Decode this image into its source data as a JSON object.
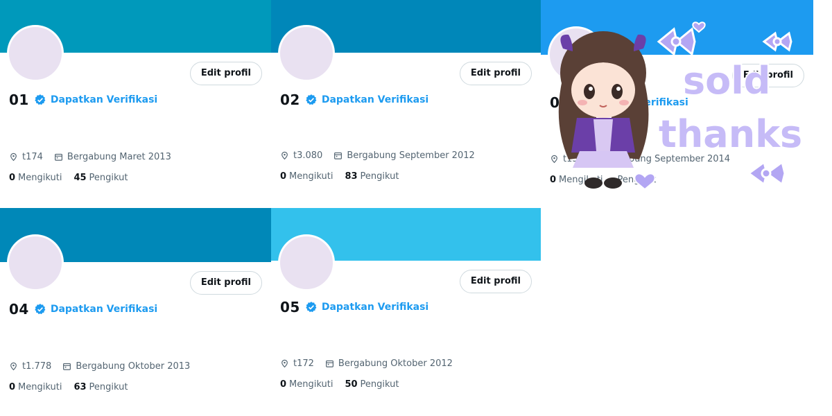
{
  "cards": [
    {
      "name": "01",
      "verify_label": "Dapatkan Verifikasi",
      "edit_label": "Edit profil",
      "location": "t174",
      "joined": "Bergabung Maret 2013",
      "following_count": "0",
      "following_label": "Mengikuti",
      "followers_count": "45",
      "followers_label": "Pengikut",
      "banner_color": "#0099bb"
    },
    {
      "name": "02",
      "verify_label": "Dapatkan Verifikasi",
      "edit_label": "Edit profil",
      "location": "t3.080",
      "joined": "Bergabung September 2012",
      "following_count": "0",
      "following_label": "Mengikuti",
      "followers_count": "83",
      "followers_label": "Pengikut",
      "banner_color": "#0087b9"
    },
    {
      "name": "0",
      "verify_label": "Dapatkan Verifikasi",
      "edit_label": "Edit profil",
      "location": "t13",
      "joined": "Bergabung September 2014",
      "following_count": "0",
      "following_label": "Mengikuti",
      "followers_count": "",
      "followers_label": "Pengikut",
      "banner_color": "#1d9bf0"
    },
    {
      "name": "04",
      "verify_label": "Dapatkan Verifikasi",
      "edit_label": "Edit profil",
      "location": "t1.778",
      "joined": "Bergabung Oktober 2013",
      "following_count": "0",
      "following_label": "Mengikuti",
      "followers_count": "63",
      "followers_label": "Pengikut",
      "banner_color": "#0088b8"
    },
    {
      "name": "05",
      "verify_label": "Dapatkan Verifikasi",
      "edit_label": "Edit profil",
      "location": "t172",
      "joined": "Bergabung Oktober 2012",
      "following_count": "0",
      "following_label": "Mengikuti",
      "followers_count": "50",
      "followers_label": "Pengikut",
      "banner_color": "#33c1ec"
    }
  ],
  "overlay": {
    "word1": "sold",
    "word2": "thanks"
  },
  "colors": {
    "link": "#1d9bf0",
    "avatar": "#e9e1f1",
    "sticker_purple": "#a99cf0"
  }
}
